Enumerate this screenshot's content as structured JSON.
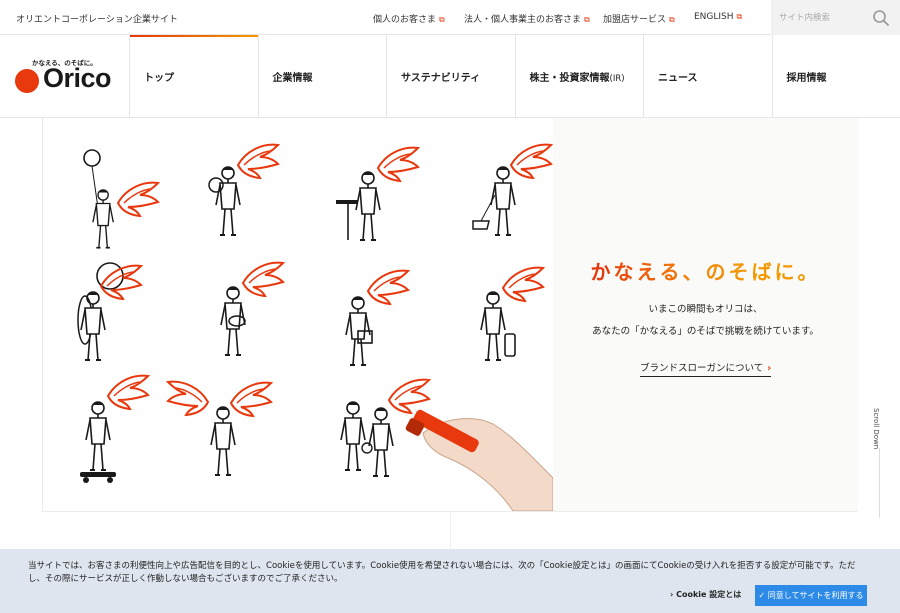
{
  "topbar": {
    "site_name": "オリエントコーポレーション企業サイト",
    "links": [
      {
        "label": "個人のお客さま",
        "external_icon": "external-link-icon"
      },
      {
        "label": "法人・個人事業主のお客さま",
        "external_icon": "external-link-icon"
      },
      {
        "label": "加盟店サービス",
        "external_icon": "external-link-icon"
      },
      {
        "label": "ENGLISH",
        "external_icon": "external-link-icon"
      }
    ],
    "search": {
      "placeholder": "サイト内検索",
      "icon": "search-icon"
    }
  },
  "logo": {
    "tagline": "かなえる、のそばに。",
    "wordmark": "Orico",
    "brand_color": "#e8380d"
  },
  "nav": {
    "items": [
      {
        "label": "トップ",
        "active": true
      },
      {
        "label": "企業情報"
      },
      {
        "label": "サステナビリティ"
      },
      {
        "label": "株主・投資家情報",
        "suffix": "(IR)"
      },
      {
        "label": "ニュース"
      },
      {
        "label": "採用情報"
      }
    ],
    "accent_gradient": [
      "#e8380d",
      "#f39800"
    ]
  },
  "hero": {
    "slogan_chars": [
      "か",
      "な",
      "え",
      "る",
      "、",
      "の",
      "そ",
      "ば",
      "に",
      "。"
    ],
    "slogan_colors": [
      "#e8380d",
      "#ea4c0c",
      "#ec5f0b",
      "#ee710a",
      "#f08209",
      "#f18d08",
      "#f29506",
      "#f39800",
      "#f39800",
      "#f39800"
    ],
    "copy_line1": "いまこの瞬間もオリコは、",
    "copy_line2": "あなたの「かなえる」のそばで挑戦を続けています。",
    "link_label": "ブランドスローガンについて"
  },
  "scroll_label": "Scroll Down",
  "cookie": {
    "text": "当サイトでは、お客さまの利便性向上や広告配信を目的とし、Cookieを使用しています。Cookie使用を希望されない場合には、次の「Cookie設定とは」の画面にてCookieの受け入れを拒否する設定が可能です。ただし、その際にサービスが正しく作動しない場合もございますのでご了承ください。",
    "settings_label": "Cookie 設定とは",
    "accept_label": "✓ 同意してサイトを利用する",
    "banner_color": "#dfe5ee",
    "accept_color": "#2d8ae6"
  }
}
